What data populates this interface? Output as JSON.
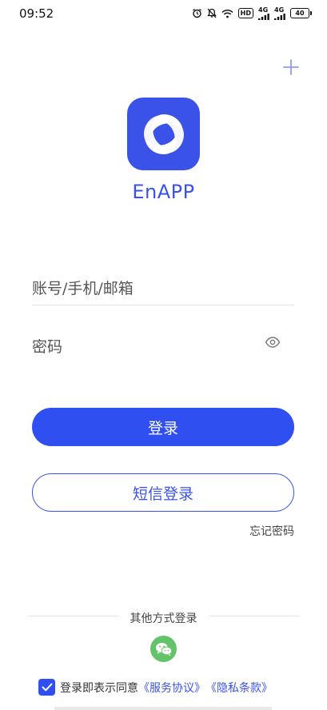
{
  "status_bar": {
    "time": "09:52",
    "hd_badge": "HD",
    "signal_1": "4G",
    "signal_2": "4G",
    "battery": "40"
  },
  "app": {
    "name": "EnAPP",
    "brand_color": "#3a52e8"
  },
  "form": {
    "account_placeholder": "账号/手机/邮箱",
    "password_placeholder": "密码"
  },
  "buttons": {
    "login": "登录",
    "sms_login": "短信登录",
    "forgot_password": "忘记密码"
  },
  "other_login": {
    "label": "其他方式登录",
    "wechat_color": "#62c36a"
  },
  "agreement": {
    "checked": true,
    "text": "登录即表示同意",
    "service_link": "《服务协议》",
    "privacy_link": "《隐私条款》"
  },
  "icons": {
    "plus": "plus-icon",
    "eye": "eye-icon",
    "wechat": "wechat-icon",
    "check": "check-icon"
  }
}
